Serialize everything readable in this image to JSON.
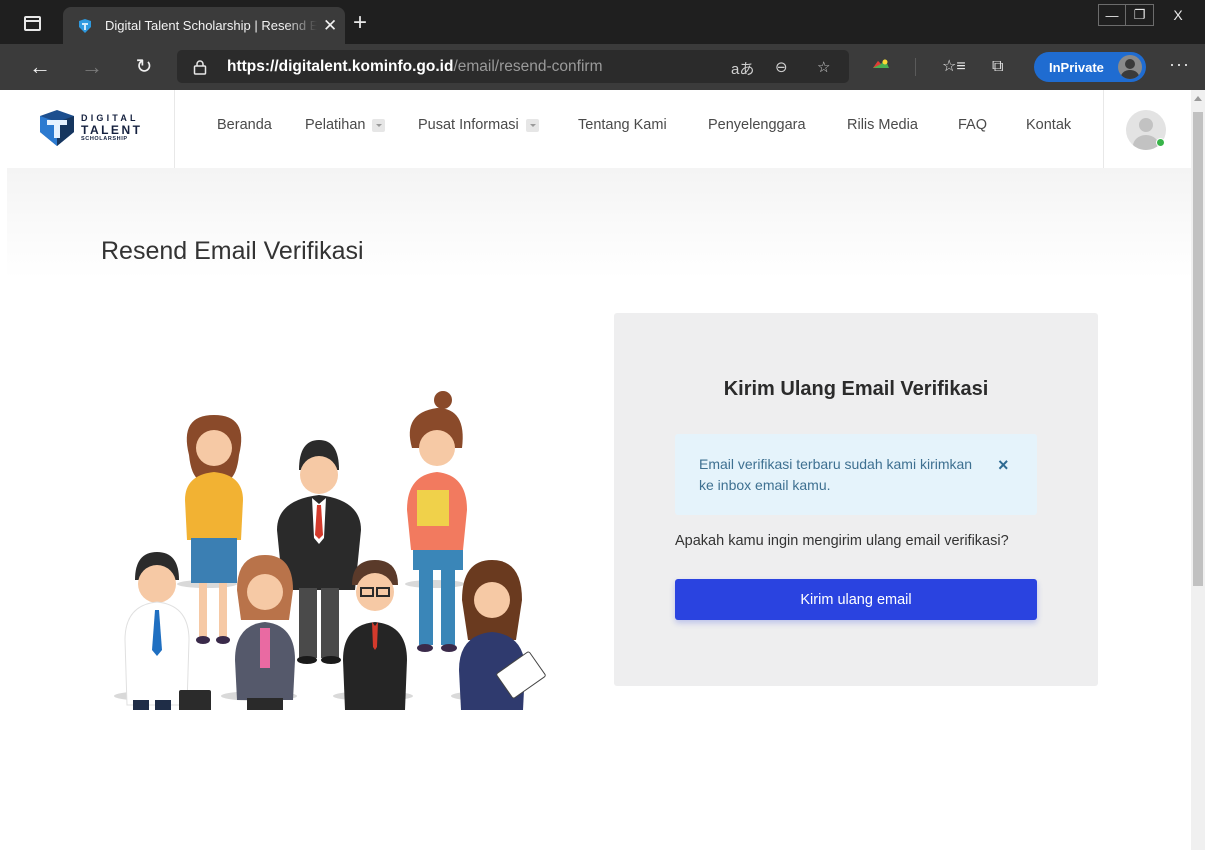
{
  "browser": {
    "tab_title": "Digital Talent Scholarship | Resend Email Verifikasi",
    "tab_close": "✕",
    "new_tab": "+",
    "url_scheme": "https://",
    "url_host": "digitalent.kominfo.go.id",
    "url_path": "/email/resend-confirm",
    "inprivate_label": "InPrivate",
    "more_label": "···",
    "window_controls": {
      "minimize": "—",
      "maximize": "❐",
      "close": "X"
    }
  },
  "site": {
    "logo": {
      "line1": "DIGITAL",
      "line2": "TALENT",
      "line3": "SCHOLARSHIP"
    },
    "nav": [
      {
        "label": "Beranda",
        "has_dropdown": false
      },
      {
        "label": "Pelatihan",
        "has_dropdown": true
      },
      {
        "label": "Pusat Informasi",
        "has_dropdown": true
      },
      {
        "label": "Tentang Kami",
        "has_dropdown": false
      },
      {
        "label": "Penyelenggara",
        "has_dropdown": false
      },
      {
        "label": "Rilis Media",
        "has_dropdown": false
      },
      {
        "label": "FAQ",
        "has_dropdown": false
      },
      {
        "label": "Kontak",
        "has_dropdown": false
      }
    ],
    "user_status_color": "#38b449"
  },
  "page": {
    "title": "Resend Email Verifikasi",
    "card": {
      "title": "Kirim Ulang Email Verifikasi",
      "alert_text": "Email verifikasi terbaru sudah kami kirimkan ke inbox email kamu.",
      "alert_close": "×",
      "question": "Apakah kamu ingin mengirim ulang email verifikasi?",
      "button_label": "Kirim ulang email"
    }
  },
  "colors": {
    "primary_button": "#2a43e0",
    "alert_bg": "#e5f3fb",
    "alert_text": "#3e7091",
    "card_bg": "#eeeeef",
    "inprivate_badge": "#1f6cd1"
  }
}
